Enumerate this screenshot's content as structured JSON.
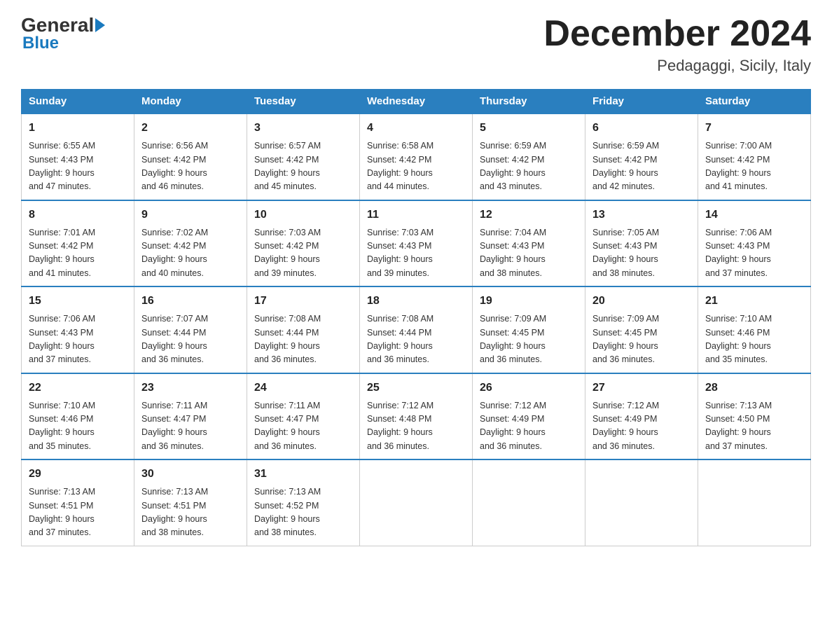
{
  "header": {
    "logo_general": "General",
    "logo_blue": "Blue",
    "month_title": "December 2024",
    "location": "Pedagaggi, Sicily, Italy"
  },
  "weekdays": [
    "Sunday",
    "Monday",
    "Tuesday",
    "Wednesday",
    "Thursday",
    "Friday",
    "Saturday"
  ],
  "weeks": [
    [
      {
        "day": "1",
        "sunrise": "6:55 AM",
        "sunset": "4:43 PM",
        "daylight": "9 hours and 47 minutes."
      },
      {
        "day": "2",
        "sunrise": "6:56 AM",
        "sunset": "4:42 PM",
        "daylight": "9 hours and 46 minutes."
      },
      {
        "day": "3",
        "sunrise": "6:57 AM",
        "sunset": "4:42 PM",
        "daylight": "9 hours and 45 minutes."
      },
      {
        "day": "4",
        "sunrise": "6:58 AM",
        "sunset": "4:42 PM",
        "daylight": "9 hours and 44 minutes."
      },
      {
        "day": "5",
        "sunrise": "6:59 AM",
        "sunset": "4:42 PM",
        "daylight": "9 hours and 43 minutes."
      },
      {
        "day": "6",
        "sunrise": "6:59 AM",
        "sunset": "4:42 PM",
        "daylight": "9 hours and 42 minutes."
      },
      {
        "day": "7",
        "sunrise": "7:00 AM",
        "sunset": "4:42 PM",
        "daylight": "9 hours and 41 minutes."
      }
    ],
    [
      {
        "day": "8",
        "sunrise": "7:01 AM",
        "sunset": "4:42 PM",
        "daylight": "9 hours and 41 minutes."
      },
      {
        "day": "9",
        "sunrise": "7:02 AM",
        "sunset": "4:42 PM",
        "daylight": "9 hours and 40 minutes."
      },
      {
        "day": "10",
        "sunrise": "7:03 AM",
        "sunset": "4:42 PM",
        "daylight": "9 hours and 39 minutes."
      },
      {
        "day": "11",
        "sunrise": "7:03 AM",
        "sunset": "4:43 PM",
        "daylight": "9 hours and 39 minutes."
      },
      {
        "day": "12",
        "sunrise": "7:04 AM",
        "sunset": "4:43 PM",
        "daylight": "9 hours and 38 minutes."
      },
      {
        "day": "13",
        "sunrise": "7:05 AM",
        "sunset": "4:43 PM",
        "daylight": "9 hours and 38 minutes."
      },
      {
        "day": "14",
        "sunrise": "7:06 AM",
        "sunset": "4:43 PM",
        "daylight": "9 hours and 37 minutes."
      }
    ],
    [
      {
        "day": "15",
        "sunrise": "7:06 AM",
        "sunset": "4:43 PM",
        "daylight": "9 hours and 37 minutes."
      },
      {
        "day": "16",
        "sunrise": "7:07 AM",
        "sunset": "4:44 PM",
        "daylight": "9 hours and 36 minutes."
      },
      {
        "day": "17",
        "sunrise": "7:08 AM",
        "sunset": "4:44 PM",
        "daylight": "9 hours and 36 minutes."
      },
      {
        "day": "18",
        "sunrise": "7:08 AM",
        "sunset": "4:44 PM",
        "daylight": "9 hours and 36 minutes."
      },
      {
        "day": "19",
        "sunrise": "7:09 AM",
        "sunset": "4:45 PM",
        "daylight": "9 hours and 36 minutes."
      },
      {
        "day": "20",
        "sunrise": "7:09 AM",
        "sunset": "4:45 PM",
        "daylight": "9 hours and 36 minutes."
      },
      {
        "day": "21",
        "sunrise": "7:10 AM",
        "sunset": "4:46 PM",
        "daylight": "9 hours and 35 minutes."
      }
    ],
    [
      {
        "day": "22",
        "sunrise": "7:10 AM",
        "sunset": "4:46 PM",
        "daylight": "9 hours and 35 minutes."
      },
      {
        "day": "23",
        "sunrise": "7:11 AM",
        "sunset": "4:47 PM",
        "daylight": "9 hours and 36 minutes."
      },
      {
        "day": "24",
        "sunrise": "7:11 AM",
        "sunset": "4:47 PM",
        "daylight": "9 hours and 36 minutes."
      },
      {
        "day": "25",
        "sunrise": "7:12 AM",
        "sunset": "4:48 PM",
        "daylight": "9 hours and 36 minutes."
      },
      {
        "day": "26",
        "sunrise": "7:12 AM",
        "sunset": "4:49 PM",
        "daylight": "9 hours and 36 minutes."
      },
      {
        "day": "27",
        "sunrise": "7:12 AM",
        "sunset": "4:49 PM",
        "daylight": "9 hours and 36 minutes."
      },
      {
        "day": "28",
        "sunrise": "7:13 AM",
        "sunset": "4:50 PM",
        "daylight": "9 hours and 37 minutes."
      }
    ],
    [
      {
        "day": "29",
        "sunrise": "7:13 AM",
        "sunset": "4:51 PM",
        "daylight": "9 hours and 37 minutes."
      },
      {
        "day": "30",
        "sunrise": "7:13 AM",
        "sunset": "4:51 PM",
        "daylight": "9 hours and 38 minutes."
      },
      {
        "day": "31",
        "sunrise": "7:13 AM",
        "sunset": "4:52 PM",
        "daylight": "9 hours and 38 minutes."
      },
      null,
      null,
      null,
      null
    ]
  ],
  "labels": {
    "sunrise_prefix": "Sunrise: ",
    "sunset_prefix": "Sunset: ",
    "daylight_prefix": "Daylight: "
  }
}
